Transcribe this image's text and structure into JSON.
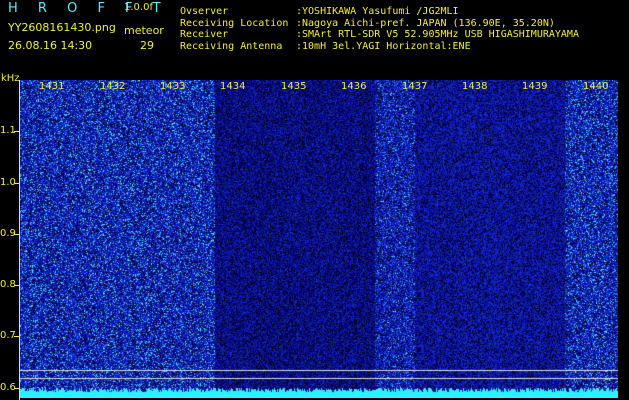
{
  "header": {
    "app_title": "H R O F F T",
    "version": "1.0.0f",
    "filename": "YY2608161430.png",
    "meteor_label": "meteor",
    "datetime": "26.08.16 14:30",
    "meteor_count": "29",
    "info": [
      {
        "key": "Ovserver",
        "value": ":YOSHIKAWA Yasufumi /JG2MLI"
      },
      {
        "key": "Receiving Location",
        "value": ":Nagoya Aichi-pref. JAPAN (136.90E, 35.20N)"
      },
      {
        "key": "Receiver",
        "value": ":SMArt RTL-SDR V5 52.905MHz USB HIGASHIMURAYAMA"
      },
      {
        "key": "Receiving Antenna",
        "value": ":10mH 3el.YAGI Horizontal:ENE"
      }
    ]
  },
  "chart_data": {
    "type": "heatmap",
    "ylabel": "kHz",
    "y_ticks": [
      "1.1",
      "1.0",
      "0.9",
      "0.8",
      "0.7",
      "0.6"
    ],
    "y_tick_values": [
      1.1,
      1.0,
      0.9,
      0.8,
      0.7,
      0.6
    ],
    "ylim": [
      0.58,
      1.2
    ],
    "x_ticks": [
      "1431",
      "1432",
      "1433",
      "1434",
      "1435",
      "1436",
      "1437",
      "1438",
      "1439",
      "1440"
    ],
    "x_tick_values": [
      1431,
      1432,
      1433,
      1434,
      1435,
      1436,
      1437,
      1438,
      1439,
      1440
    ],
    "xlim": [
      1430.5,
      1440.4
    ],
    "grid": false
  },
  "colors": {
    "header_cyan": "#4ff0ff",
    "label_yellow": "#f2ee3a",
    "background": "#000000",
    "noise_blue": "#1420c8",
    "hline": "#dcdcdc"
  }
}
